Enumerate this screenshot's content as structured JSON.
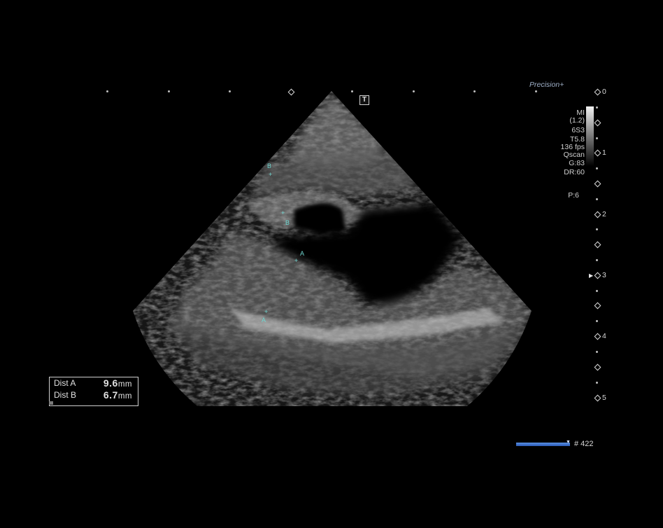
{
  "brand": {
    "prefix": "P",
    "rest": "recision",
    "plus": "+"
  },
  "top_marker": "T",
  "params": [
    "MI",
    "(1.2)",
    "6S3",
    "T5.8",
    "136 fps",
    "Qscan",
    "G:83",
    "DR:60"
  ],
  "preset": "P:6",
  "depth_scale": [
    "0",
    "1",
    "2",
    "3",
    "4",
    "5"
  ],
  "calipers": {
    "a": "A",
    "b": "B"
  },
  "measurements": [
    {
      "label": "Dist A",
      "value": "9.6",
      "unit": "mm"
    },
    {
      "label": "Dist B",
      "value": "6.7",
      "unit": "mm"
    }
  ],
  "cine": {
    "frame": "# 422"
  },
  "colors": {
    "background": "#000000",
    "caliper": "#6fd6d0",
    "cine_bar": "#3a70d0"
  }
}
